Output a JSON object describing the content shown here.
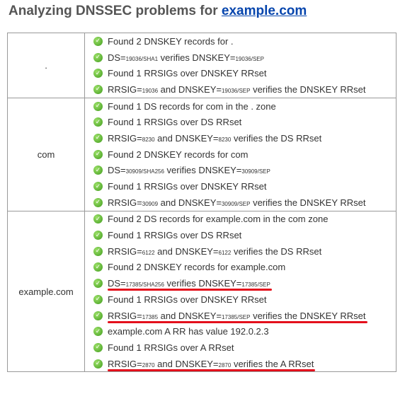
{
  "page": {
    "title_prefix": "Analyzing DNSSEC problems for ",
    "title_link": "example.com"
  },
  "zones": [
    {
      "name": ".",
      "checks": [
        [
          {
            "t": "Found 2 DNSKEY records for ."
          }
        ],
        [
          {
            "t": "DS="
          },
          {
            "t": "19036/SHA1",
            "s": 1
          },
          {
            "t": " verifies DNSKEY="
          },
          {
            "t": "19036/SEP",
            "s": 1
          }
        ],
        [
          {
            "t": "Found 1 RRSIGs over DNSKEY RRset"
          }
        ],
        [
          {
            "t": "RRSIG="
          },
          {
            "t": "19036",
            "s": 1
          },
          {
            "t": " and DNSKEY="
          },
          {
            "t": "19036/SEP",
            "s": 1
          },
          {
            "t": " verifies the DNSKEY RRset"
          }
        ]
      ]
    },
    {
      "name": "com",
      "checks": [
        [
          {
            "t": "Found 1 DS records for com in the . zone"
          }
        ],
        [
          {
            "t": "Found 1 RRSIGs over DS RRset"
          }
        ],
        [
          {
            "t": "RRSIG="
          },
          {
            "t": "8230",
            "s": 1
          },
          {
            "t": " and DNSKEY="
          },
          {
            "t": "8230",
            "s": 1
          },
          {
            "t": " verifies the DS RRset"
          }
        ],
        [
          {
            "t": "Found 2 DNSKEY records for com"
          }
        ],
        [
          {
            "t": "DS="
          },
          {
            "t": "30909/SHA256",
            "s": 1
          },
          {
            "t": " verifies DNSKEY="
          },
          {
            "t": "30909/SEP",
            "s": 1
          }
        ],
        [
          {
            "t": "Found 1 RRSIGs over DNSKEY RRset"
          }
        ],
        [
          {
            "t": "RRSIG="
          },
          {
            "t": "30909",
            "s": 1
          },
          {
            "t": " and DNSKEY="
          },
          {
            "t": "30909/SEP",
            "s": 1
          },
          {
            "t": " verifies the DNSKEY RRset"
          }
        ]
      ]
    },
    {
      "name": "example.com",
      "checks": [
        [
          {
            "t": "Found 2 DS records for example.com in the com zone"
          }
        ],
        [
          {
            "t": "Found 1 RRSIGs over DS RRset"
          }
        ],
        [
          {
            "t": "RRSIG="
          },
          {
            "t": "6122",
            "s": 1
          },
          {
            "t": " and DNSKEY="
          },
          {
            "t": "6122",
            "s": 1
          },
          {
            "t": " verifies the DS RRset"
          }
        ],
        [
          {
            "t": "Found 2 DNSKEY records for example.com"
          }
        ],
        [
          {
            "t": "DS="
          },
          {
            "t": "17385/SHA256",
            "s": 1
          },
          {
            "t": " verifies DNSKEY="
          },
          {
            "t": "17385/SEP",
            "s": 1
          }
        ],
        [
          {
            "t": "Found 1 RRSIGs over DNSKEY RRset"
          }
        ],
        [
          {
            "t": "RRSIG="
          },
          {
            "t": "17385",
            "s": 1
          },
          {
            "t": " and DNSKEY="
          },
          {
            "t": "17385/SEP",
            "s": 1
          },
          {
            "t": " verifies the DNSKEY RRset"
          }
        ],
        [
          {
            "t": "example.com A RR has value 192.0.2.3"
          }
        ],
        [
          {
            "t": "Found 1 RRSIGs over A RRset"
          }
        ],
        [
          {
            "t": "RRSIG="
          },
          {
            "t": "2870",
            "s": 1
          },
          {
            "t": " and DNSKEY="
          },
          {
            "t": "2870",
            "s": 1
          },
          {
            "t": " verifies the A RRset"
          }
        ]
      ],
      "highlighted_checks": [
        4,
        6,
        9
      ]
    }
  ],
  "colors": {
    "status_ok": "#3f9b1c",
    "highlight": "#e4101c",
    "link": "#0645ad"
  },
  "icons": {
    "status": "check-circle-icon"
  }
}
